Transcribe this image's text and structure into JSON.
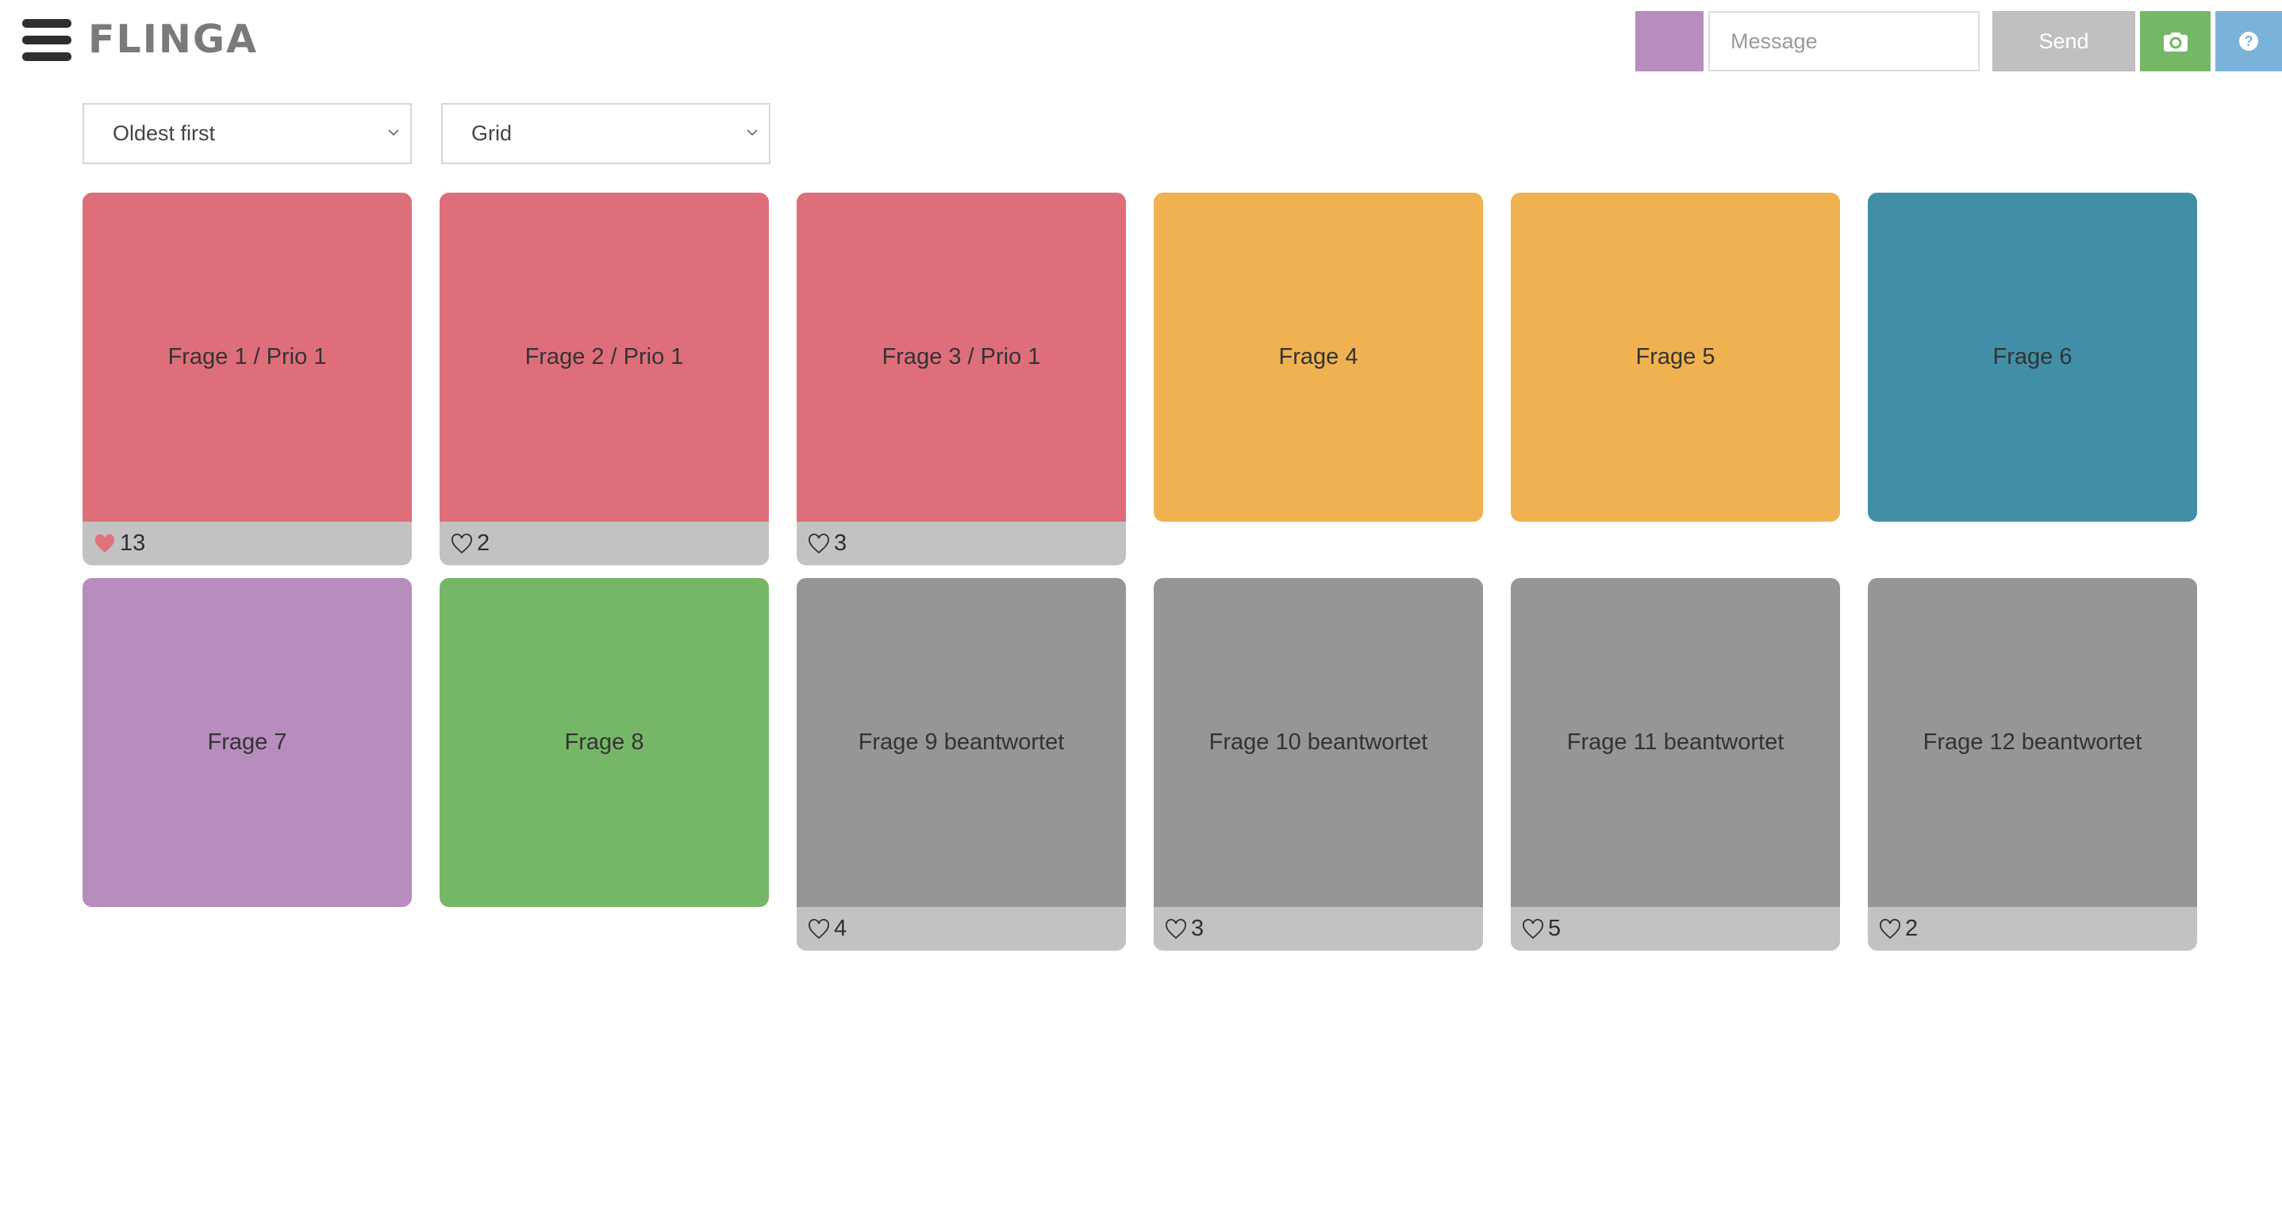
{
  "header": {
    "logo": "FLINGA",
    "menu_icon": "hamburger-menu-icon",
    "color_swatch": "#b68dbd",
    "message_placeholder": "Message",
    "message_value": "",
    "send_label": "Send",
    "send_bg": "#c0c0c0",
    "camera_icon": "camera-icon",
    "camera_bg": "#76b767",
    "help_icon": "question-circle-icon",
    "help_bg": "#7bb2d9"
  },
  "controls": {
    "sort": {
      "selected": "Oldest first"
    },
    "view": {
      "selected": "Grid"
    }
  },
  "cards": [
    {
      "title": "Frage 1 / Prio 1",
      "color": "#df6e7b",
      "likes": "13",
      "liked": true
    },
    {
      "title": "Frage 2 / Prio 1",
      "color": "#df6e7b",
      "likes": "2",
      "liked": false
    },
    {
      "title": "Frage 3 / Prio 1",
      "color": "#df6e7b",
      "likes": "3",
      "liked": false
    },
    {
      "title": "Frage 4",
      "color": "#f0b251",
      "likes": null,
      "liked": false
    },
    {
      "title": "Frage 5",
      "color": "#f0b251",
      "likes": null,
      "liked": false
    },
    {
      "title": "Frage 6",
      "color": "#418ea7",
      "likes": null,
      "liked": false
    },
    {
      "title": "Frage 7",
      "color": "#b68dbd",
      "likes": null,
      "liked": false
    },
    {
      "title": "Frage 8",
      "color": "#76b767",
      "likes": null,
      "liked": false
    },
    {
      "title": "Frage 9 beantwortet",
      "color": "#969696",
      "likes": "4",
      "liked": false
    },
    {
      "title": "Frage 10 beantwortet",
      "color": "#969696",
      "likes": "3",
      "liked": false
    },
    {
      "title": "Frage 11 beantwortet",
      "color": "#969696",
      "likes": "5",
      "liked": false
    },
    {
      "title": "Frage 12 beantwortet",
      "color": "#969696",
      "likes": "2",
      "liked": false
    }
  ],
  "colors": {
    "liked_heart": "#e0737a",
    "footer_bg": "#c2c2c2"
  }
}
